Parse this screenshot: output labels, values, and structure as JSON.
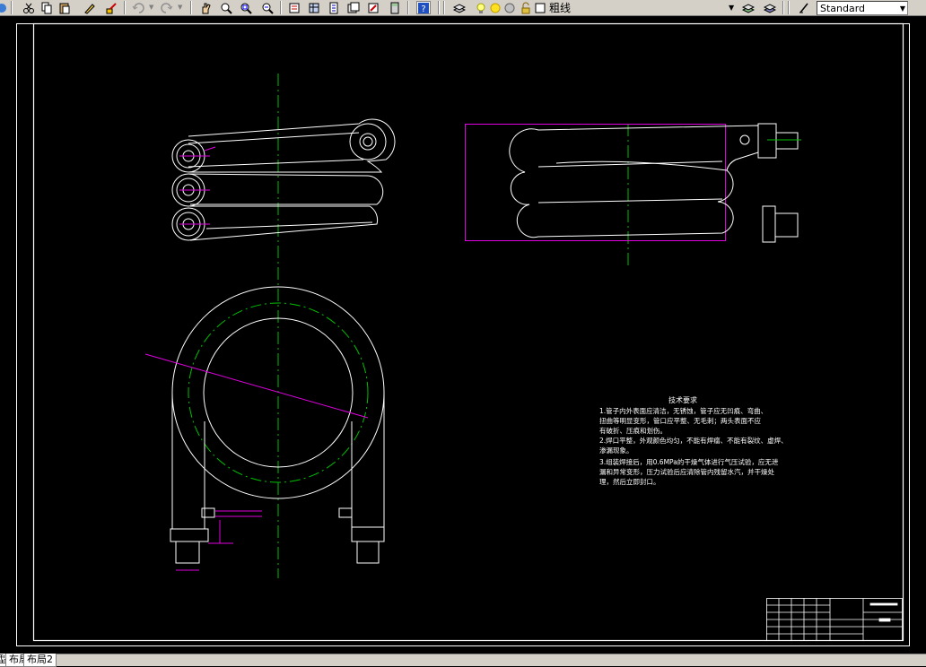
{
  "toolbar": {
    "layer_combo": {
      "value": "粗线"
    },
    "style_combo": {
      "value": "Standard"
    },
    "icons": [
      "cut-icon",
      "copy-icon",
      "paste-icon",
      "match-properties-icon",
      "brush-icon",
      "undo-icon",
      "redo-icon",
      "pan-icon",
      "zoom-realtime-icon",
      "zoom-window-icon",
      "zoom-previous-icon",
      "properties-icon",
      "design-center-icon",
      "tool-palettes-icon",
      "sheet-set-icon",
      "markup-icon",
      "calculator-icon",
      "help-icon",
      "layer-manager-icon",
      "bulb-icon",
      "sun-icon",
      "freeze-icon",
      "lock-icon",
      "color-icon"
    ]
  },
  "drawing": {
    "tech_requirements": {
      "title": "技术要求",
      "lines": [
        "1.管子内外表面应清洁，无锈蚀，管子应无凹痕、弯曲、",
        "  扭曲等明显变形，管口应平整、无毛刺；两头表面不应",
        "  有破折、压痕和划伤。",
        "2.焊口平整，外观颜色均匀，不能有焊瘤、不能有裂纹、虚焊、",
        "  渗漏现象。",
        "3.组装焊接后，用0.6MPa的干燥气体进行气压试验，应无泄",
        "  漏和异常变形，压力试验后应清除管内残留水汽，并干燥处",
        "  理，然后立即封口。"
      ]
    }
  },
  "layout_tabs": {
    "model_partial": "型",
    "tabs": [
      "布局1",
      "布局2"
    ]
  }
}
